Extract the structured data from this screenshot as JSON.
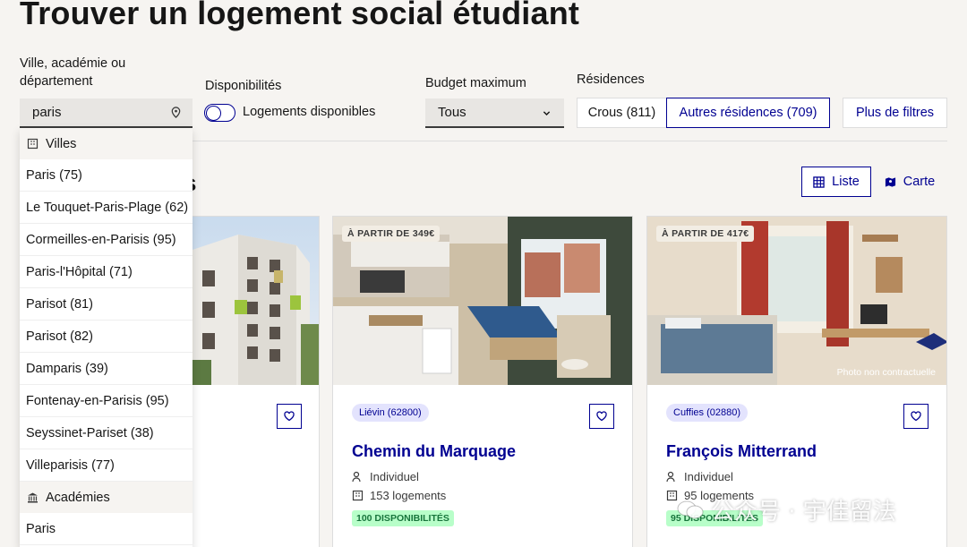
{
  "page": {
    "title": "Trouver un logement social étudiant"
  },
  "filters": {
    "location_label": "Ville, académie ou département",
    "location_value": "paris",
    "dispo_label": "Disponibilités",
    "dispo_toggle_label": "Logements disponibles",
    "budget_label": "Budget maximum",
    "budget_value": "Tous",
    "residences_label": "Résidences",
    "crous_button": "Crous (811)",
    "autres_button": "Autres résidences (709)",
    "more_filters_button": "Plus de filtres"
  },
  "results": {
    "heading_fragment": "s",
    "view_list": "Liste",
    "view_map": "Carte"
  },
  "dropdown": {
    "group_villes": "Villes",
    "villes": [
      "Paris (75)",
      "Le Touquet-Paris-Plage (62)",
      "Cormeilles-en-Parisis (95)",
      "Paris-l'Hôpital (71)",
      "Parisot (81)",
      "Parisot (82)",
      "Damparis (39)",
      "Fontenay-en-Parisis (95)",
      "Seyssinet-Pariset (38)",
      "Villeparisis (77)"
    ],
    "group_academies": "Académies",
    "academies": [
      "Paris"
    ]
  },
  "cards": [
    {},
    {
      "price": "À PARTIR DE 349€",
      "city": "Liévin (62800)",
      "title": "Chemin du Marquage",
      "type": "Individuel",
      "units": "153 logements",
      "availability": "100 DISPONIBILITÉS"
    },
    {
      "price": "À PARTIR DE 417€",
      "photo_note": "Photo non contractuelle",
      "city": "Cuffies (02880)",
      "title": "François Mitterrand",
      "type": "Individuel",
      "units": "95 logements",
      "availability": "95 DISPONIBILITÉS"
    }
  ],
  "watermark": {
    "text": "公众号 · 宇佳留法"
  },
  "colors": {
    "primary": "#000091",
    "success_bg": "#b8fec9",
    "success_text": "#18753c"
  }
}
